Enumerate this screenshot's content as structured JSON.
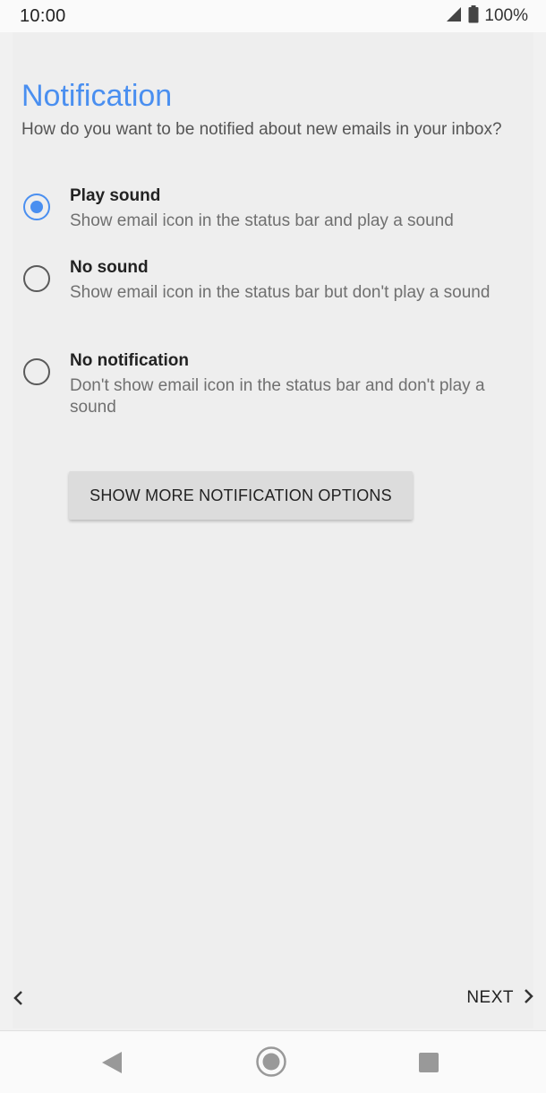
{
  "status_bar": {
    "time": "10:00",
    "battery_text": "100%",
    "icons": [
      "signal-icon",
      "battery-icon"
    ]
  },
  "page": {
    "title": "Notification",
    "subtitle": "How do you want to be notified about new emails in your inbox?"
  },
  "options": [
    {
      "label": "Play sound",
      "description": "Show email icon in the status bar and play a sound",
      "selected": true
    },
    {
      "label": "No sound",
      "description": "Show email icon in the status bar but don't play a sound",
      "selected": false
    },
    {
      "label": "No notification",
      "description": "Don't show email icon in the status bar and don't play a sound",
      "selected": false
    }
  ],
  "more_button": {
    "label": "SHOW MORE NOTIFICATION OPTIONS"
  },
  "footer": {
    "next_label": "NEXT",
    "back_icon": "chevron-left-icon",
    "next_icon": "chevron-right-icon"
  },
  "nav_bar": {
    "icons": [
      "nav-back-icon",
      "nav-home-icon",
      "nav-recents-icon"
    ]
  },
  "colors": {
    "accent": "#4a8ff0",
    "background": "#eeeeee",
    "button": "#dcdcdc"
  }
}
